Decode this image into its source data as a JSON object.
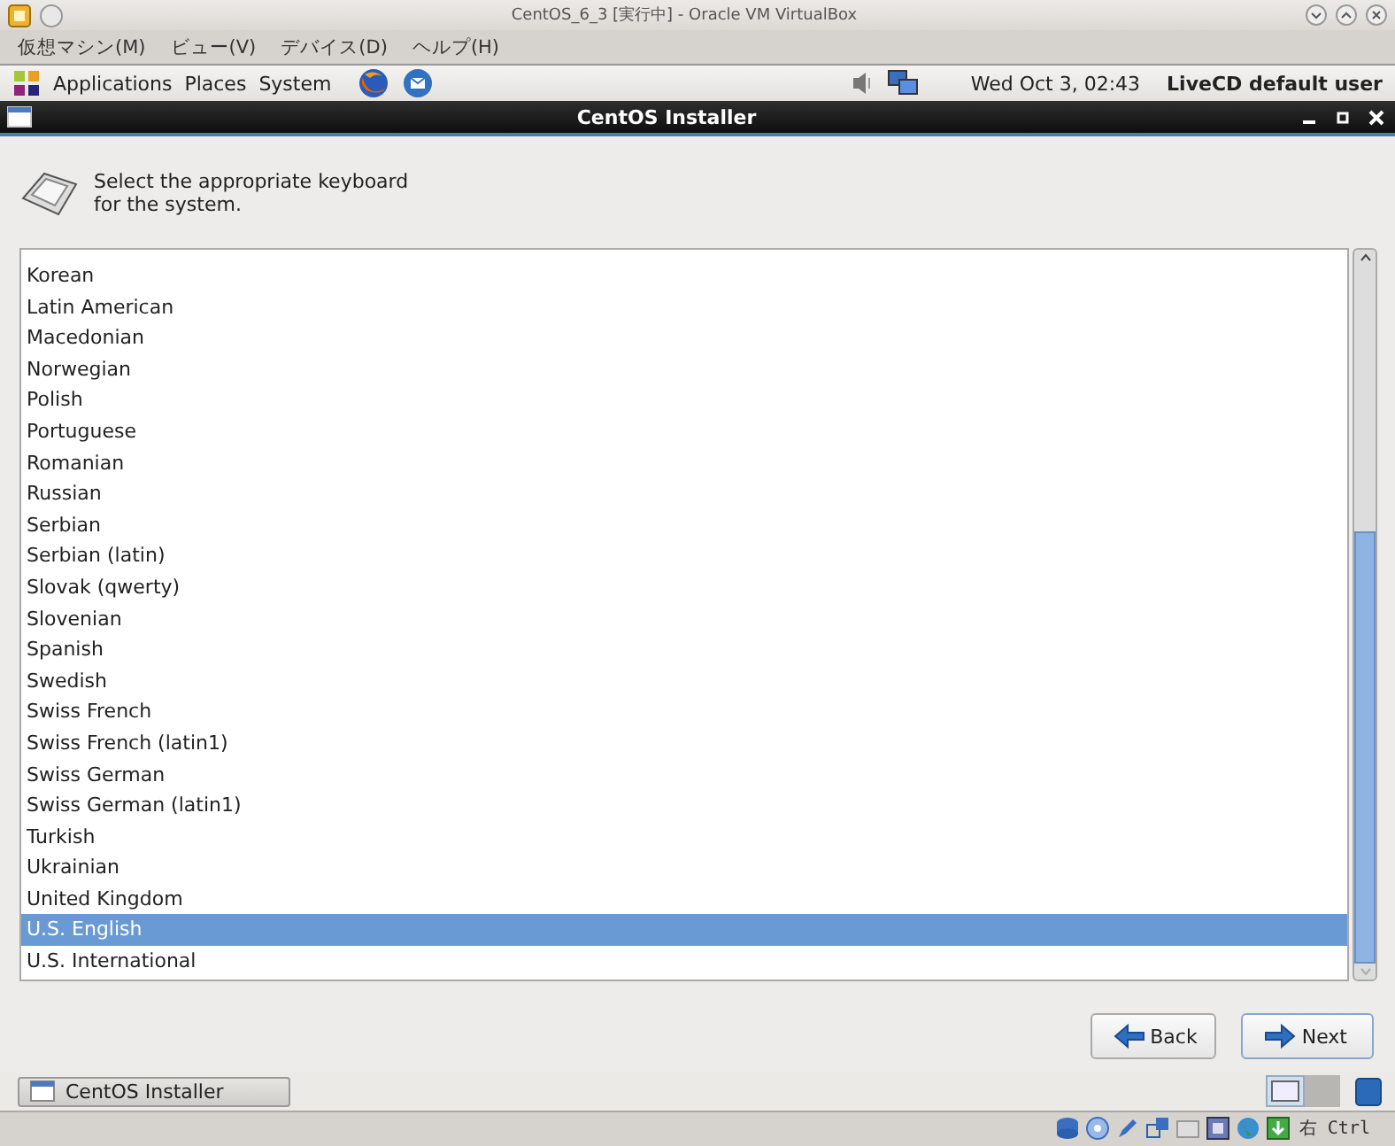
{
  "host_window": {
    "title": "CentOS_6_3 [実行中] - Oracle VM VirtualBox"
  },
  "host_menu": [
    "仮想マシン(M)",
    "ビュー(V)",
    "デバイス(D)",
    "ヘルプ(H)"
  ],
  "panel": {
    "menus": [
      "Applications",
      "Places",
      "System"
    ],
    "clock": "Wed Oct  3, 02:43",
    "user": "LiveCD default user"
  },
  "installer": {
    "title": "CentOS Installer",
    "prompt": "Select the appropriate keyboard for the system.",
    "keyboards": [
      {
        "label": "Korean",
        "selected": false
      },
      {
        "label": "Latin American",
        "selected": false
      },
      {
        "label": "Macedonian",
        "selected": false
      },
      {
        "label": "Norwegian",
        "selected": false
      },
      {
        "label": "Polish",
        "selected": false
      },
      {
        "label": "Portuguese",
        "selected": false
      },
      {
        "label": "Romanian",
        "selected": false
      },
      {
        "label": "Russian",
        "selected": false
      },
      {
        "label": "Serbian",
        "selected": false
      },
      {
        "label": "Serbian (latin)",
        "selected": false
      },
      {
        "label": "Slovak (qwerty)",
        "selected": false
      },
      {
        "label": "Slovenian",
        "selected": false
      },
      {
        "label": "Spanish",
        "selected": false
      },
      {
        "label": "Swedish",
        "selected": false
      },
      {
        "label": "Swiss French",
        "selected": false
      },
      {
        "label": "Swiss French (latin1)",
        "selected": false
      },
      {
        "label": "Swiss German",
        "selected": false
      },
      {
        "label": "Swiss German (latin1)",
        "selected": false
      },
      {
        "label": "Turkish",
        "selected": false
      },
      {
        "label": "Ukrainian",
        "selected": false
      },
      {
        "label": "United Kingdom",
        "selected": false
      },
      {
        "label": "U.S. English",
        "selected": true
      },
      {
        "label": "U.S. International",
        "selected": false
      }
    ],
    "buttons": [
      {
        "label": "Back",
        "kind": "back"
      },
      {
        "label": "Next",
        "kind": "next"
      }
    ]
  },
  "taskbar": [
    {
      "label": "CentOS Installer"
    }
  ],
  "host_status": {
    "host_key": "右 Ctrl"
  }
}
